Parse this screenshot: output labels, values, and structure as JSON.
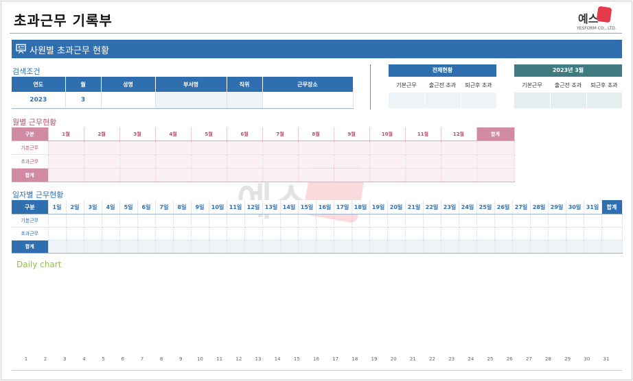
{
  "page": {
    "title": "초과근무 기록부"
  },
  "logo": {
    "text": "예스",
    "subtitle": "YESFORM CO., LTD."
  },
  "section": {
    "title": "사원별 초과근무 현황"
  },
  "search": {
    "label": "검색조건",
    "headers": [
      "연도",
      "월",
      "성명",
      "부서명",
      "직위",
      "근무장소"
    ],
    "values": [
      "2023",
      "3",
      "",
      "",
      "",
      ""
    ]
  },
  "summary_total": {
    "title": "전체현황",
    "headers": [
      "기본근무",
      "출근전 초과",
      "퇴근후 초과"
    ],
    "color": "#2f6fb0"
  },
  "summary_month": {
    "title": "2023년 3월",
    "headers": [
      "기본근무",
      "출근전 초과",
      "퇴근후 초과"
    ],
    "color": "#3f7b80"
  },
  "monthly": {
    "label": "월별 근무현황",
    "corner": "구분",
    "months": [
      "1월",
      "2월",
      "3월",
      "4월",
      "5월",
      "6월",
      "7월",
      "8월",
      "9월",
      "10월",
      "11월",
      "12월"
    ],
    "total": "합계",
    "rows": [
      "기본근무",
      "초과근무",
      "합계"
    ]
  },
  "daily": {
    "label": "일자별 근무현황",
    "corner": "구분",
    "days": [
      "1일",
      "2일",
      "3일",
      "4일",
      "5일",
      "6일",
      "7일",
      "8일",
      "9일",
      "10일",
      "11일",
      "12일",
      "13일",
      "14일",
      "15일",
      "16일",
      "17일",
      "18일",
      "19일",
      "20일",
      "21일",
      "22일",
      "23일",
      "24일",
      "25일",
      "26일",
      "27일",
      "28일",
      "29일",
      "30일",
      "31일"
    ],
    "total": "합계",
    "rows": [
      "기본근무",
      "초과근무",
      "합계"
    ]
  },
  "chart": {
    "label": "Daily chart",
    "x_ticks": [
      "1",
      "2",
      "3",
      "4",
      "5",
      "6",
      "7",
      "8",
      "9",
      "10",
      "11",
      "12",
      "13",
      "14",
      "15",
      "16",
      "17",
      "18",
      "19",
      "20",
      "21",
      "22",
      "23",
      "24",
      "25",
      "26",
      "27",
      "28",
      "29",
      "30",
      "31"
    ]
  },
  "watermark": {
    "text": "예스"
  },
  "colors": {
    "accent": "#2f6fb0",
    "rose": "#d18aa3",
    "teal": "#3f7b80",
    "chart_label": "#8cc63f"
  }
}
